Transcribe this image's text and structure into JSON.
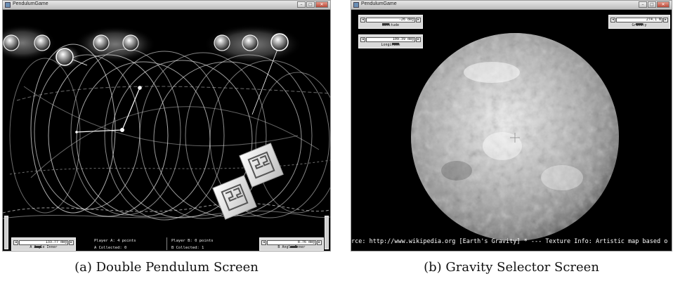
{
  "panel_a": {
    "window_title": "PendulumGame",
    "caption": "(a) Double Pendulum Screen",
    "left_slider": {
      "value": "133.77 deg",
      "label": "A Angle Inner",
      "level": 0.37
    },
    "right_slider": {
      "value": "8.76 deg",
      "label": "B Angle Inner",
      "level": 0.55
    },
    "player_a_points": "Player A: 4 points",
    "player_a_collected": "A Collected: 0",
    "player_b_points": "Player B: 0 points",
    "player_b_collected": "B Collected: 1"
  },
  "panel_b": {
    "window_title": "PendulumGame",
    "caption": "(b) Gravity Selector Screen",
    "latitude_slider": {
      "value": "-26 deg",
      "label": "Latitude",
      "level": 0.38
    },
    "longitude_slider": {
      "value": "109.39 deg",
      "label": "Longitude",
      "level": 0.62
    },
    "gravity_slider": {
      "value": "274.1 N",
      "label": "Gravity",
      "level": 0.5
    },
    "ticker": "rce: http://www.wikipedia.org [Earth's Gravity]  *  --- Texture Info: Artistic map based o"
  }
}
